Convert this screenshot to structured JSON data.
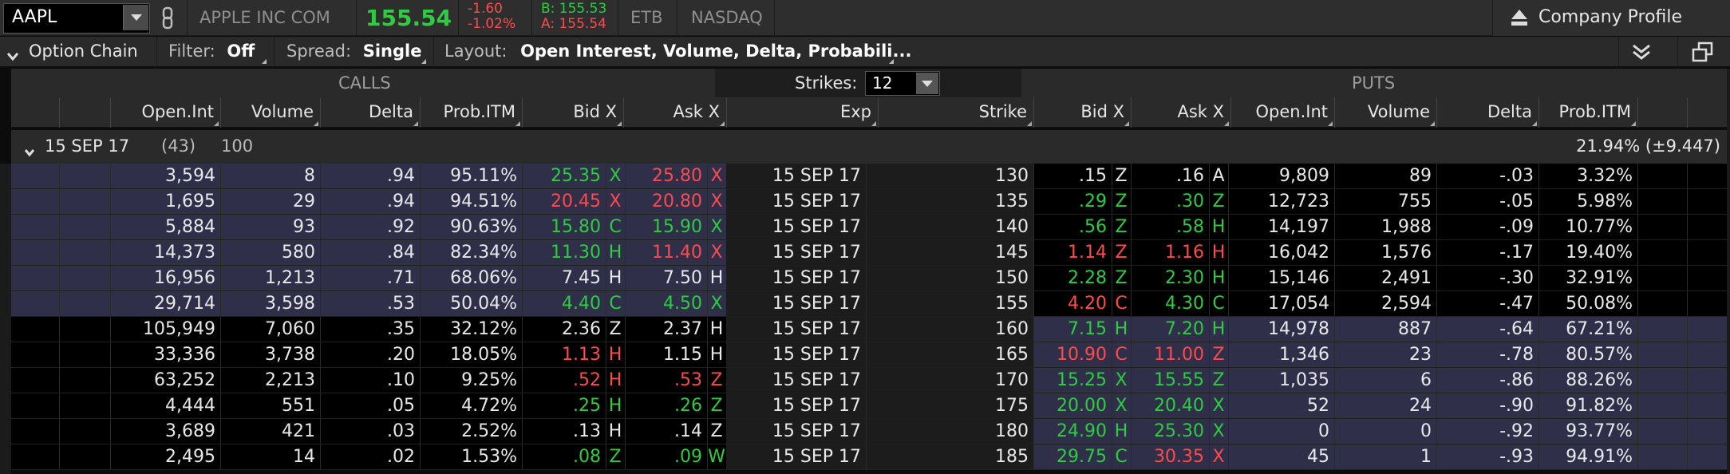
{
  "header": {
    "symbol": "AAPL",
    "company": "APPLE INC COM",
    "last": "155.54",
    "change": "-1.60",
    "change_pct": "-1.02%",
    "bid": "B: 155.53",
    "ask": "A: 155.54",
    "etb": "ETB",
    "exchange": "NASDAQ",
    "company_profile": "Company Profile"
  },
  "toolbar": {
    "option_chain": "Option Chain",
    "filter_label": "Filter:",
    "filter_value": "Off",
    "spread_label": "Spread:",
    "spread_value": "Single",
    "layout_label": "Layout:",
    "layout_value": "Open Interest, Volume, Delta, Probabili..."
  },
  "groups": {
    "calls": "CALLS",
    "puts": "PUTS",
    "strikes_label": "Strikes:",
    "strikes_value": "12"
  },
  "columns": {
    "calls": [
      "Open.Int",
      "Volume",
      "Delta",
      "Prob.ITM",
      "Bid X",
      "Ask X"
    ],
    "mid": [
      "Exp",
      "Strike"
    ],
    "puts": [
      "Bid X",
      "Ask X",
      "Open.Int",
      "Volume",
      "Delta",
      "Prob.ITM"
    ]
  },
  "expiration": {
    "date": "15 SEP 17",
    "days": "(43)",
    "multiplier": "100",
    "iv": "21.94% (±9.447)"
  },
  "colors": {
    "green": "#2ecc40",
    "red": "#ff4b4b",
    "itm_bg": "#2f2f4a",
    "otm_bg": "#000000",
    "mid_bg": "#1c1c1c"
  },
  "rows": [
    {
      "call_oi": "3,594",
      "call_vol": "8",
      "call_delta": ".94",
      "call_prob": "95.11%",
      "call_bid": "25.35",
      "call_bid_c": "g",
      "call_bid_x": "X",
      "call_ask": "25.80",
      "call_ask_c": "r",
      "call_ask_x": "X",
      "exp": "15 SEP 17",
      "strike": "130",
      "put_bid": ".15",
      "put_bid_c": "w",
      "put_bid_x": "Z",
      "put_ask": ".16",
      "put_ask_c": "w",
      "put_ask_x": "A",
      "put_oi": "9,809",
      "put_vol": "89",
      "put_delta": "-.03",
      "put_prob": "3.32%",
      "call_itm": true,
      "put_itm": false
    },
    {
      "call_oi": "1,695",
      "call_vol": "29",
      "call_delta": ".94",
      "call_prob": "94.51%",
      "call_bid": "20.45",
      "call_bid_c": "r",
      "call_bid_x": "X",
      "call_ask": "20.80",
      "call_ask_c": "r",
      "call_ask_x": "X",
      "exp": "15 SEP 17",
      "strike": "135",
      "put_bid": ".29",
      "put_bid_c": "g",
      "put_bid_x": "Z",
      "put_ask": ".30",
      "put_ask_c": "g",
      "put_ask_x": "Z",
      "put_oi": "12,723",
      "put_vol": "755",
      "put_delta": "-.05",
      "put_prob": "5.98%",
      "call_itm": true,
      "put_itm": false
    },
    {
      "call_oi": "5,884",
      "call_vol": "93",
      "call_delta": ".92",
      "call_prob": "90.63%",
      "call_bid": "15.80",
      "call_bid_c": "g",
      "call_bid_x": "C",
      "call_ask": "15.90",
      "call_ask_c": "g",
      "call_ask_x": "X",
      "exp": "15 SEP 17",
      "strike": "140",
      "put_bid": ".56",
      "put_bid_c": "g",
      "put_bid_x": "Z",
      "put_ask": ".58",
      "put_ask_c": "g",
      "put_ask_x": "H",
      "put_oi": "14,197",
      "put_vol": "1,988",
      "put_delta": "-.09",
      "put_prob": "10.77%",
      "call_itm": true,
      "put_itm": false
    },
    {
      "call_oi": "14,373",
      "call_vol": "580",
      "call_delta": ".84",
      "call_prob": "82.34%",
      "call_bid": "11.30",
      "call_bid_c": "g",
      "call_bid_x": "H",
      "call_ask": "11.40",
      "call_ask_c": "r",
      "call_ask_x": "X",
      "exp": "15 SEP 17",
      "strike": "145",
      "put_bid": "1.14",
      "put_bid_c": "r",
      "put_bid_x": "Z",
      "put_ask": "1.16",
      "put_ask_c": "r",
      "put_ask_x": "H",
      "put_oi": "16,042",
      "put_vol": "1,576",
      "put_delta": "-.17",
      "put_prob": "19.40%",
      "call_itm": true,
      "put_itm": false
    },
    {
      "call_oi": "16,956",
      "call_vol": "1,213",
      "call_delta": ".71",
      "call_prob": "68.06%",
      "call_bid": "7.45",
      "call_bid_c": "w",
      "call_bid_x": "H",
      "call_ask": "7.50",
      "call_ask_c": "w",
      "call_ask_x": "H",
      "exp": "15 SEP 17",
      "strike": "150",
      "put_bid": "2.28",
      "put_bid_c": "g",
      "put_bid_x": "Z",
      "put_ask": "2.30",
      "put_ask_c": "g",
      "put_ask_x": "H",
      "put_oi": "15,146",
      "put_vol": "2,491",
      "put_delta": "-.30",
      "put_prob": "32.91%",
      "call_itm": true,
      "put_itm": false
    },
    {
      "call_oi": "29,714",
      "call_vol": "3,598",
      "call_delta": ".53",
      "call_prob": "50.04%",
      "call_bid": "4.40",
      "call_bid_c": "g",
      "call_bid_x": "C",
      "call_ask": "4.50",
      "call_ask_c": "g",
      "call_ask_x": "X",
      "exp": "15 SEP 17",
      "strike": "155",
      "put_bid": "4.20",
      "put_bid_c": "r",
      "put_bid_x": "C",
      "put_ask": "4.30",
      "put_ask_c": "g",
      "put_ask_x": "C",
      "put_oi": "17,054",
      "put_vol": "2,594",
      "put_delta": "-.47",
      "put_prob": "50.08%",
      "call_itm": true,
      "put_itm": false
    },
    {
      "call_oi": "105,949",
      "call_vol": "7,060",
      "call_delta": ".35",
      "call_prob": "32.12%",
      "call_bid": "2.36",
      "call_bid_c": "w",
      "call_bid_x": "Z",
      "call_ask": "2.37",
      "call_ask_c": "w",
      "call_ask_x": "H",
      "exp": "15 SEP 17",
      "strike": "160",
      "put_bid": "7.15",
      "put_bid_c": "g",
      "put_bid_x": "H",
      "put_ask": "7.20",
      "put_ask_c": "g",
      "put_ask_x": "H",
      "put_oi": "14,978",
      "put_vol": "887",
      "put_delta": "-.64",
      "put_prob": "67.21%",
      "call_itm": false,
      "put_itm": true
    },
    {
      "call_oi": "33,336",
      "call_vol": "3,738",
      "call_delta": ".20",
      "call_prob": "18.05%",
      "call_bid": "1.13",
      "call_bid_c": "r",
      "call_bid_x": "H",
      "call_ask": "1.15",
      "call_ask_c": "w",
      "call_ask_x": "H",
      "exp": "15 SEP 17",
      "strike": "165",
      "put_bid": "10.90",
      "put_bid_c": "r",
      "put_bid_x": "C",
      "put_ask": "11.00",
      "put_ask_c": "r",
      "put_ask_x": "Z",
      "put_oi": "1,346",
      "put_vol": "23",
      "put_delta": "-.78",
      "put_prob": "80.57%",
      "call_itm": false,
      "put_itm": true
    },
    {
      "call_oi": "63,252",
      "call_vol": "2,213",
      "call_delta": ".10",
      "call_prob": "9.25%",
      "call_bid": ".52",
      "call_bid_c": "r",
      "call_bid_x": "H",
      "call_ask": ".53",
      "call_ask_c": "r",
      "call_ask_x": "Z",
      "exp": "15 SEP 17",
      "strike": "170",
      "put_bid": "15.25",
      "put_bid_c": "g",
      "put_bid_x": "X",
      "put_ask": "15.55",
      "put_ask_c": "g",
      "put_ask_x": "Z",
      "put_oi": "1,035",
      "put_vol": "6",
      "put_delta": "-.86",
      "put_prob": "88.26%",
      "call_itm": false,
      "put_itm": true
    },
    {
      "call_oi": "4,444",
      "call_vol": "551",
      "call_delta": ".05",
      "call_prob": "4.72%",
      "call_bid": ".25",
      "call_bid_c": "g",
      "call_bid_x": "H",
      "call_ask": ".26",
      "call_ask_c": "g",
      "call_ask_x": "Z",
      "exp": "15 SEP 17",
      "strike": "175",
      "put_bid": "20.00",
      "put_bid_c": "g",
      "put_bid_x": "X",
      "put_ask": "20.40",
      "put_ask_c": "g",
      "put_ask_x": "X",
      "put_oi": "52",
      "put_vol": "24",
      "put_delta": "-.90",
      "put_prob": "91.82%",
      "call_itm": false,
      "put_itm": true
    },
    {
      "call_oi": "3,689",
      "call_vol": "421",
      "call_delta": ".03",
      "call_prob": "2.52%",
      "call_bid": ".13",
      "call_bid_c": "w",
      "call_bid_x": "H",
      "call_ask": ".14",
      "call_ask_c": "w",
      "call_ask_x": "Z",
      "exp": "15 SEP 17",
      "strike": "180",
      "put_bid": "24.90",
      "put_bid_c": "g",
      "put_bid_x": "H",
      "put_ask": "25.30",
      "put_ask_c": "g",
      "put_ask_x": "X",
      "put_oi": "0",
      "put_vol": "0",
      "put_delta": "-.92",
      "put_prob": "93.77%",
      "call_itm": false,
      "put_itm": true
    },
    {
      "call_oi": "2,495",
      "call_vol": "14",
      "call_delta": ".02",
      "call_prob": "1.53%",
      "call_bid": ".08",
      "call_bid_c": "g",
      "call_bid_x": "Z",
      "call_ask": ".09",
      "call_ask_c": "g",
      "call_ask_x": "W",
      "exp": "15 SEP 17",
      "strike": "185",
      "put_bid": "29.75",
      "put_bid_c": "g",
      "put_bid_x": "C",
      "put_ask": "30.35",
      "put_ask_c": "r",
      "put_ask_x": "X",
      "put_oi": "45",
      "put_vol": "1",
      "put_delta": "-.93",
      "put_prob": "94.91%",
      "call_itm": false,
      "put_itm": true
    }
  ]
}
